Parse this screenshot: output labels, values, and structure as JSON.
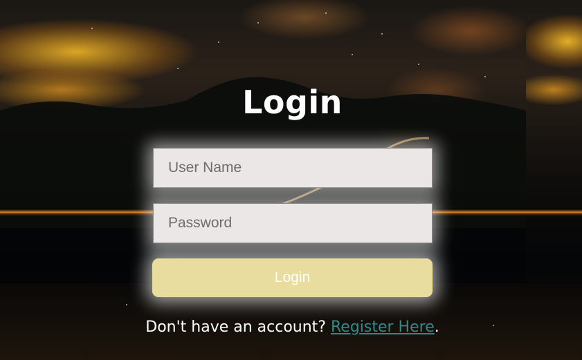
{
  "login": {
    "title": "Login",
    "username_placeholder": "User Name",
    "password_placeholder": "Password",
    "button_label": "Login",
    "register_prompt": "Don't have an account? ",
    "register_link_label": "Register Here",
    "register_suffix": "."
  },
  "colors": {
    "button_bg": "#e8dc9e",
    "field_bg": "#ebe7e6",
    "link": "#2e8c8a",
    "text": "#ffffff"
  }
}
